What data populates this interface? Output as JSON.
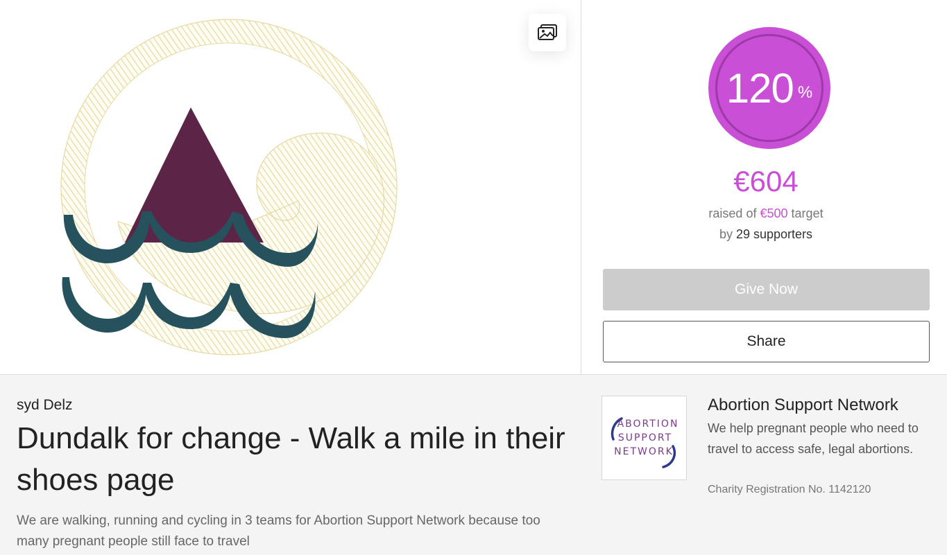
{
  "hero": {
    "logo_icon": "abortion-support-network-wave-logo",
    "gallery_icon": "image-gallery-icon"
  },
  "progress": {
    "percent": "120",
    "percent_sign": "%",
    "percent_value": 120,
    "color": "#c84fd6"
  },
  "fundraising": {
    "raised_amount": "€604",
    "raised_prefix": "raised of",
    "target_amount": "€500",
    "target_suffix": "target",
    "supporters_prefix": "by",
    "supporters_text": "29 supporters"
  },
  "actions": {
    "give_label": "Give Now",
    "share_label": "Share"
  },
  "page": {
    "owner": "syd Delz",
    "title": "Dundalk for change - Walk a mile in their shoes page",
    "description": "We are walking, running and cycling in 3 teams for Abortion Support Network because too many pregnant people still face to travel"
  },
  "charity": {
    "logo_lines": [
      "ABORTION",
      "SUPPORT",
      "NETWORK"
    ],
    "name": "Abortion Support Network",
    "description": "We help pregnant people who need to travel to access safe, legal abortions.",
    "registration": "Charity Registration No. 1142120"
  },
  "colors": {
    "accent": "#c84fd6",
    "button_disabled": "#cccccc",
    "logo_gold": "#e6d9a4",
    "logo_plum": "#5c2548",
    "logo_teal": "#25525c"
  }
}
